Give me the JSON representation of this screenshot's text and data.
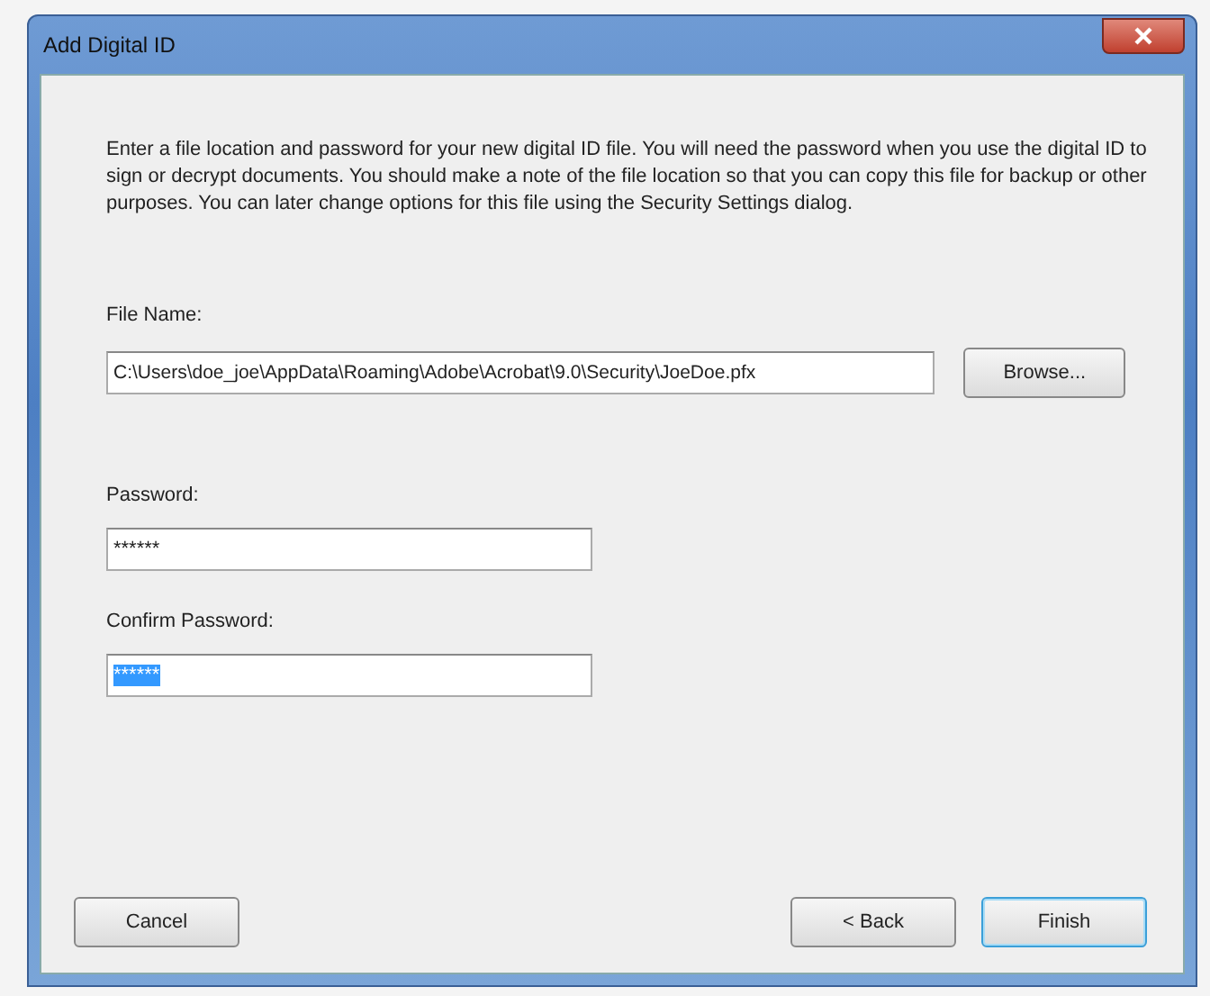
{
  "window": {
    "title": "Add Digital ID"
  },
  "intro": "Enter a file location and password for your new digital ID file. You will need the password when you use the digital ID to sign or decrypt documents. You should make a note of the file location so that you can copy this file for backup or other purposes. You can later change options for this file using the Security Settings dialog.",
  "file_name": {
    "label": "File Name:",
    "value": "C:\\Users\\doe_joe\\AppData\\Roaming\\Adobe\\Acrobat\\9.0\\Security\\JoeDoe.pfx",
    "button": "Browse..."
  },
  "password": {
    "label": "Password:",
    "value": "******",
    "text_selected": false
  },
  "confirm_password": {
    "label": "Confirm Password:",
    "value": "******",
    "text_selected": true
  },
  "buttons": [
    {
      "label": "Cancel",
      "focused": false
    },
    {
      "label": "< Back",
      "focused": false
    },
    {
      "label": "Finish",
      "focused": true
    }
  ]
}
